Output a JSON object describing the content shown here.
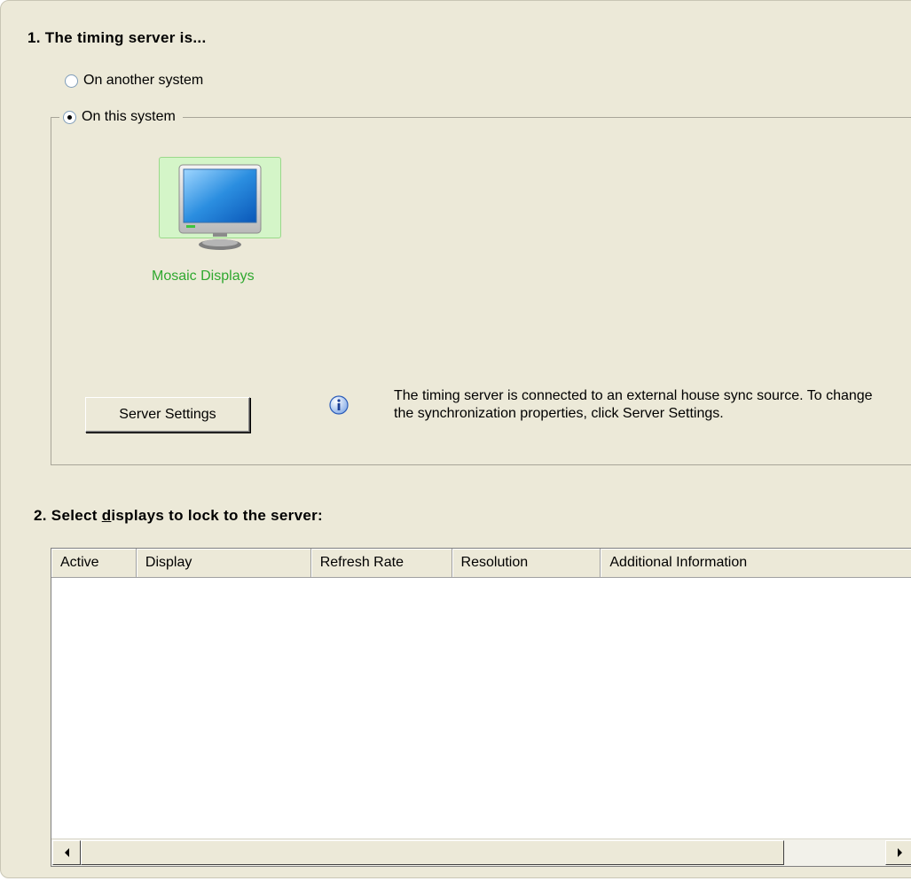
{
  "section1": {
    "heading": "1. The timing server is...",
    "option_another": "On another system",
    "option_this": "On this system",
    "selected": "On this system",
    "mosaic_label": "Mosaic Displays",
    "server_settings_button": "Server Settings",
    "info_icon": "info-icon",
    "info_text": "The timing server is connected to an external house sync source. To change the synchronization properties, click Server Settings."
  },
  "section2": {
    "heading_prefix": "2. Select ",
    "heading_mnemonic": "d",
    "heading_suffix": "isplays to lock to the server:",
    "columns": [
      "Active",
      "Display",
      "Refresh Rate",
      "Resolution",
      "Additional Information"
    ],
    "rows": []
  },
  "colors": {
    "panel_background": "#ece9d8",
    "mosaic_tile_background": "#d4f5c8",
    "mosaic_label_color": "#2fa82f"
  }
}
